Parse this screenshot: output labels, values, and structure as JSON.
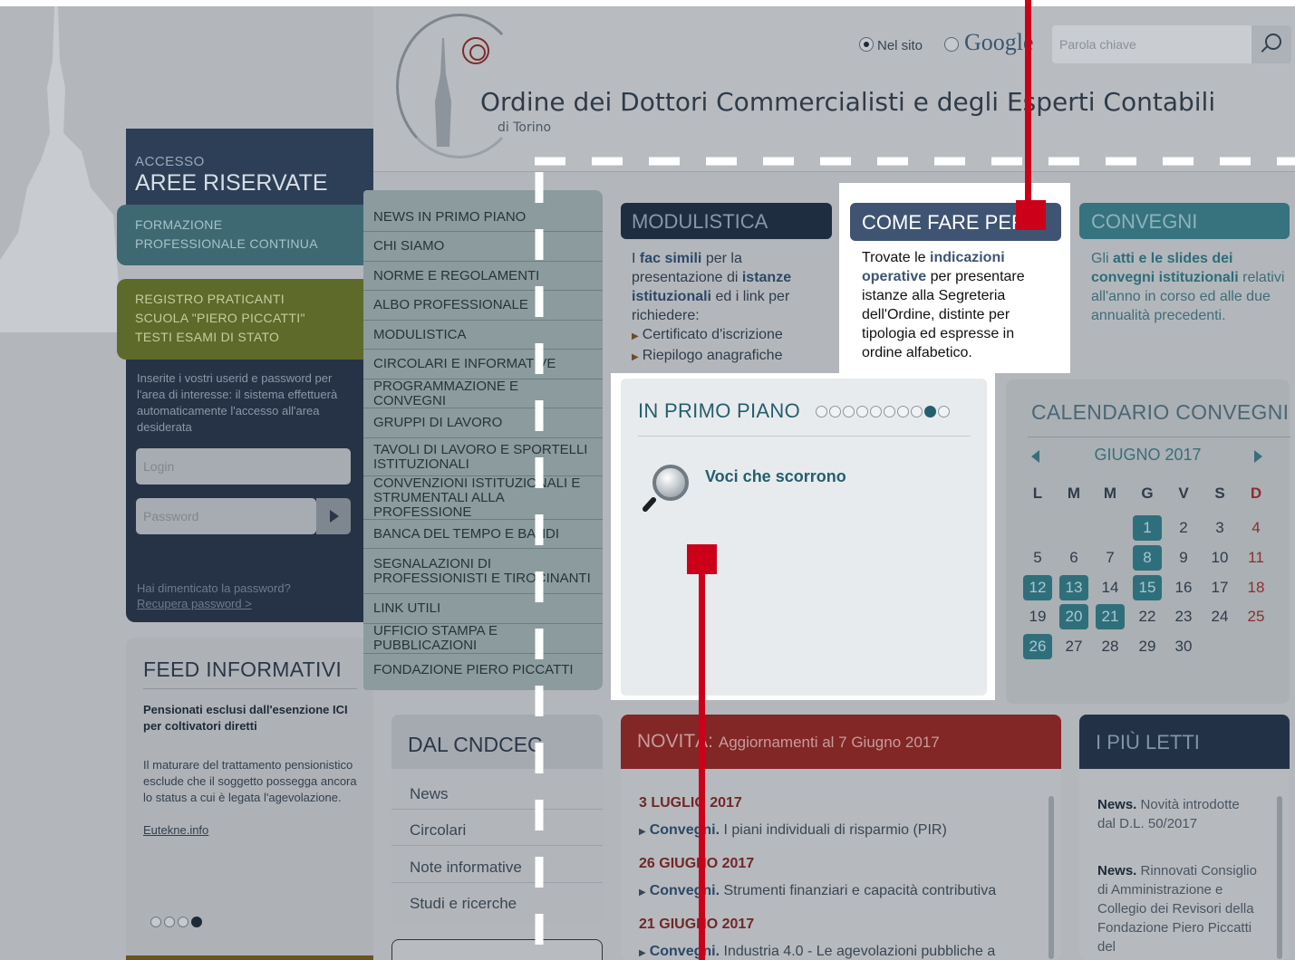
{
  "header": {
    "org_title": "Ordine dei Dottori Commercialisti e degli Esperti Contabili",
    "org_subtitle": "di Torino",
    "search_scope_site": "Nel sito",
    "search_scope_google": "Google",
    "search_placeholder": "Parola chiave"
  },
  "sidebar": {
    "access_small": "ACCESSO",
    "access_big": "AREE RISERVATE",
    "band_fpc": [
      "FORMAZIONE",
      "PROFESSIONALE CONTINUA"
    ],
    "band_reg": [
      "REGISTRO PRATICANTI",
      "SCUOLA \"PIERO PICCATTI\"",
      "TESTI ESAMI DI STATO"
    ],
    "login_intro": "Inserite i vostri userid e password per l'area di interesse: il sistema effettuerà automaticamente l'accesso all'area desiderata",
    "login_placeholder": "Login",
    "password_placeholder": "Password",
    "forgot": "Hai dimenticato la password?",
    "recover": "Recupera password >"
  },
  "feed": {
    "title": "FEED INFORMATIVI",
    "headline": "Pensionati esclusi dall'esenzione ICI per coltivatori diretti",
    "text": "Il maturare del trattamento pensionistico esclude che il soggetto possegga ancora lo status a cui è legata l'agevolazione.",
    "source": "Eutekne.info"
  },
  "nav": [
    "NEWS  IN PRIMO PIANO",
    "CHI SIAMO",
    "NORME E REGOLAMENTI",
    "ALBO PROFESSIONALE",
    "MODULISTICA",
    "CIRCOLARI E INFORMATIVE",
    "PROGRAMMAZIONE E CONVEGNI",
    "GRUPPI DI LAVORO",
    "TAVOLI DI LAVORO E SPORTELLI ISTITUZIONALI",
    "CONVENZIONI ISTITUZIONALI E STRUMENTALI ALLA PROFESSIONE",
    "BANCA DEL TEMPO E BANDI",
    "SEGNALAZIONI DI PROFESSIONISTI E TIROCINANTI",
    "LINK UTILI",
    "UFFICIO STAMPA E PUBBLICAZIONI",
    "FONDAZIONE PIERO PICCATTI"
  ],
  "modulistica": {
    "title": "MODULISTICA",
    "intro_1": "I ",
    "intro_bold_1": "fac simili",
    "intro_2": " per la presentazione di ",
    "intro_bold_2": "istanze istituzionali",
    "intro_3": " ed i link per richiedere:",
    "items": [
      "Certificato d'iscrizione",
      "Riepilogo anagrafiche"
    ]
  },
  "come_fare": {
    "title": "COME FARE PER...",
    "text_1": "Trovate le ",
    "text_bold": "indicazioni operative",
    "text_2": " per presentare istanze alla Segreteria dell'Ordine, distinte per tipologia ed espresse in ordine alfabetico."
  },
  "convegni": {
    "title": "CONVEGNI",
    "text_1": "Gli ",
    "text_bold": "atti e le slides dei convegni istituzionali",
    "text_2": " relativi all'anno in corso ed alle due annualità precedenti."
  },
  "primo_piano": {
    "title": "IN PRIMO PIANO",
    "dots_total": 10,
    "dots_active": 9,
    "item": "Voci che scorrono"
  },
  "calendar": {
    "title": "CALENDARIO CONVEGNI",
    "month": "GIUGNO 2017",
    "weekdays": [
      "L",
      "M",
      "M",
      "G",
      "V",
      "S",
      "D"
    ],
    "first_weekday_index": 3,
    "days": 30,
    "event_days": [
      1,
      8,
      12,
      13,
      15,
      20,
      21,
      26
    ]
  },
  "novita": {
    "title": "NOVITÀ:",
    "subtitle": "Aggiornamenti al 7 Giugno 2017",
    "entries": [
      {
        "date": "3 LUGLIO 2017",
        "type": "Convegni.",
        "text": " I piani individuali di risparmio (PIR)"
      },
      {
        "date": "26 GIUGNO 2017",
        "type": "Convegni.",
        "text": " Strumenti finanziari e capacità contributiva"
      },
      {
        "date": "21 GIUGNO 2017",
        "type": "Convegni.",
        "text": " Industria 4.0 - Le agevolazioni pubbliche a"
      }
    ]
  },
  "piu_letti": {
    "title": "I PIÙ LETTI",
    "items": [
      {
        "type": "News.",
        "text": " Novità introdotte dal D.L. 50/2017"
      },
      {
        "type": "News.",
        "text": " Rinnovati Consiglio di Amministrazione e Collegio dei Revisori della Fondazione Piero Piccatti del"
      }
    ]
  },
  "dal_cndcec": {
    "title": "DAL CNDCEC",
    "items": [
      "News",
      "Circolari",
      "Note informative",
      "Studi e ricerche"
    ]
  },
  "colors": {
    "accent_red": "#cc0019",
    "overlay_grey": "#b3b7bb",
    "primo_teal": "#245f6f",
    "come_blue": "#3f5473"
  }
}
